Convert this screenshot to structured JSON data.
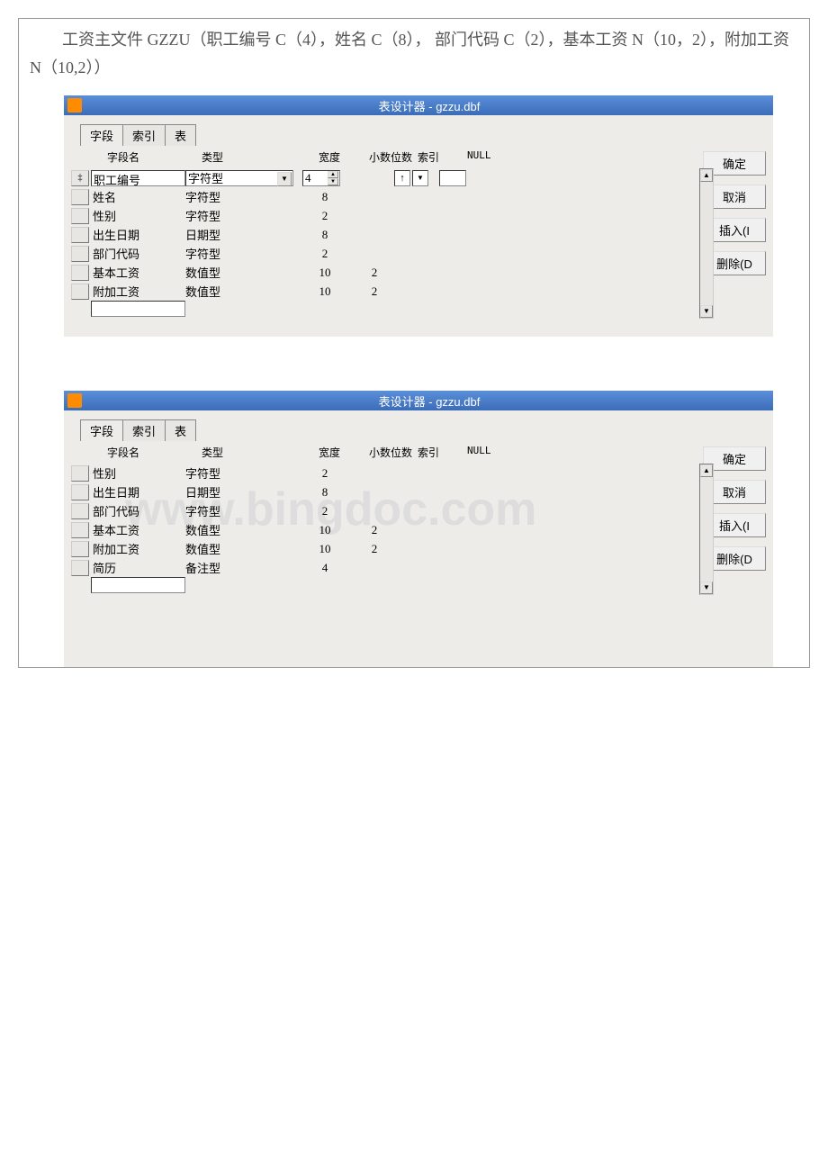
{
  "description": "　　工资主文件 GZZU（职工编号 C（4），姓名 C（8）， 部门代码 C（2），基本工资 N（10，2），附加工资 N（10,2））",
  "watermark": "www.bingdoc.com",
  "designer1": {
    "title": "表设计器 - gzzu.dbf",
    "tabs": [
      "字段",
      "索引",
      "表"
    ],
    "headers": {
      "name": "字段名",
      "type": "类型",
      "width": "宽度",
      "dec": "小数位数",
      "index": "索引",
      "null": "NULL"
    },
    "fields": [
      {
        "name": "职工编号",
        "type": "字符型",
        "width": "4",
        "dec": "",
        "active": true,
        "indexArrow": "↑"
      },
      {
        "name": "姓名",
        "type": "字符型",
        "width": "8",
        "dec": ""
      },
      {
        "name": "性别",
        "type": "字符型",
        "width": "2",
        "dec": ""
      },
      {
        "name": "出生日期",
        "type": "日期型",
        "width": "8",
        "dec": ""
      },
      {
        "name": "部门代码",
        "type": "字符型",
        "width": "2",
        "dec": ""
      },
      {
        "name": "基本工资",
        "type": "数值型",
        "width": "10",
        "dec": "2"
      },
      {
        "name": "附加工资",
        "type": "数值型",
        "width": "10",
        "dec": "2"
      }
    ],
    "buttons": {
      "ok": "确定",
      "cancel": "取消",
      "insert": "插入(I",
      "delete": "删除(D"
    }
  },
  "designer2": {
    "title": "表设计器 - gzzu.dbf",
    "tabs": [
      "字段",
      "索引",
      "表"
    ],
    "headers": {
      "name": "字段名",
      "type": "类型",
      "width": "宽度",
      "dec": "小数位数",
      "index": "索引",
      "null": "NULL"
    },
    "fields": [
      {
        "name": "性别",
        "type": "字符型",
        "width": "2",
        "dec": ""
      },
      {
        "name": "出生日期",
        "type": "日期型",
        "width": "8",
        "dec": ""
      },
      {
        "name": "部门代码",
        "type": "字符型",
        "width": "2",
        "dec": ""
      },
      {
        "name": "基本工资",
        "type": "数值型",
        "width": "10",
        "dec": "2"
      },
      {
        "name": "附加工资",
        "type": "数值型",
        "width": "10",
        "dec": "2"
      },
      {
        "name": "简历",
        "type": "备注型",
        "width": "4",
        "dec": ""
      }
    ],
    "buttons": {
      "ok": "确定",
      "cancel": "取消",
      "insert": "插入(I",
      "delete": "删除(D"
    }
  }
}
